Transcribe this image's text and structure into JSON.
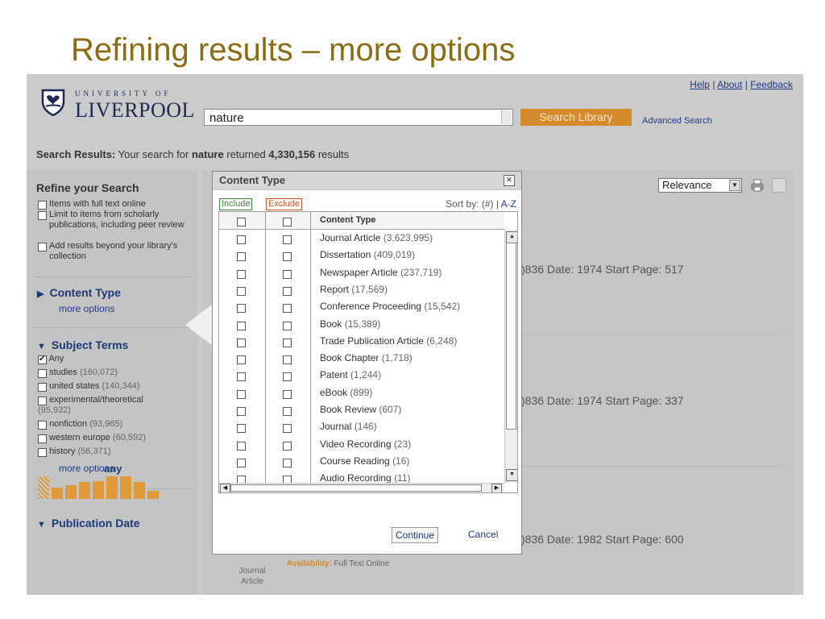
{
  "slide": {
    "title": "Refining results – more options"
  },
  "header": {
    "logo_small": "UNIVERSITY OF",
    "logo_big": "LIVERPOOL",
    "links": {
      "help": "Help",
      "about": "About",
      "feedback": "Feedback",
      "separator": "|"
    },
    "search_value": "nature",
    "search_button": "Search Library",
    "advanced_search": "Advanced Search"
  },
  "results_line": {
    "label": "Search Results:",
    "prefix": "Your search for",
    "query": "nature",
    "middle": "returned",
    "count": "4,330,156",
    "suffix": "results"
  },
  "sidebar": {
    "refine_title": "Refine your Search",
    "options": [
      "Items with full text online",
      "Limit to items from scholarly publications, including peer review",
      "Add results beyond your library's collection"
    ],
    "content_type": {
      "title": "Content Type",
      "more": "more options"
    },
    "subject_terms": {
      "title": "Subject Terms",
      "items": [
        {
          "label": "Any",
          "count": "",
          "checked": true
        },
        {
          "label": "studies",
          "count": "(160,072)",
          "checked": false
        },
        {
          "label": "united states",
          "count": "(140,344)",
          "checked": false
        },
        {
          "label": "experimental/theoretical",
          "count": "(95,932)",
          "checked": false
        },
        {
          "label": "nonfiction",
          "count": "(93,965)",
          "checked": false
        },
        {
          "label": "western europe",
          "count": "(60,592)",
          "checked": false
        },
        {
          "label": "history",
          "count": "(56,371)",
          "checked": false
        }
      ],
      "more": "more options"
    },
    "publication_date": {
      "title": "Publication Date",
      "value": "any",
      "bar_levels": [
        1.0,
        0.5,
        0.6,
        0.75,
        0.8,
        1.0,
        1.0,
        0.75,
        0.35
      ]
    }
  },
  "main": {
    "sort_value": "Relevance",
    "result_meta": [
      ")836 Date: 1974 Start Page: 517",
      ")836 Date: 1974 Start Page: 337",
      ")836 Date: 1982 Start Page: 600"
    ],
    "doc_type": "Journal Article",
    "availability_label": "Availability:",
    "availability_value": "Full Text Online"
  },
  "modal": {
    "title": "Content Type",
    "include": "Include",
    "exclude": "Exclude",
    "sort_by": "Sort by: (#) |",
    "sort_az": "A-Z",
    "column_header": "Content Type",
    "items": [
      {
        "label": "Journal Article",
        "count": "(3,623,995)"
      },
      {
        "label": "Dissertation",
        "count": "(409,019)"
      },
      {
        "label": "Newspaper Article",
        "count": "(237,719)"
      },
      {
        "label": "Report",
        "count": "(17,569)"
      },
      {
        "label": "Conference Proceeding",
        "count": "(15,542)"
      },
      {
        "label": "Book",
        "count": "(15,389)"
      },
      {
        "label": "Trade Publication Article",
        "count": "(6,248)"
      },
      {
        "label": "Book Chapter",
        "count": "(1,718)"
      },
      {
        "label": "Patent",
        "count": "(1,244)"
      },
      {
        "label": "eBook",
        "count": "(899)"
      },
      {
        "label": "Book Review",
        "count": "(607)"
      },
      {
        "label": "Journal",
        "count": "(146)"
      },
      {
        "label": "Video Recording",
        "count": "(23)"
      },
      {
        "label": "Course Reading",
        "count": "(16)"
      },
      {
        "label": "Audio Recording",
        "count": "(11)"
      }
    ],
    "continue": "Continue",
    "cancel": "Cancel"
  },
  "colors": {
    "title": "#8a6d14",
    "accent_orange": "#d58a2c",
    "link_blue": "#1f3a8c",
    "include_green": "#3b8a3b",
    "exclude_red": "#c4542a"
  }
}
